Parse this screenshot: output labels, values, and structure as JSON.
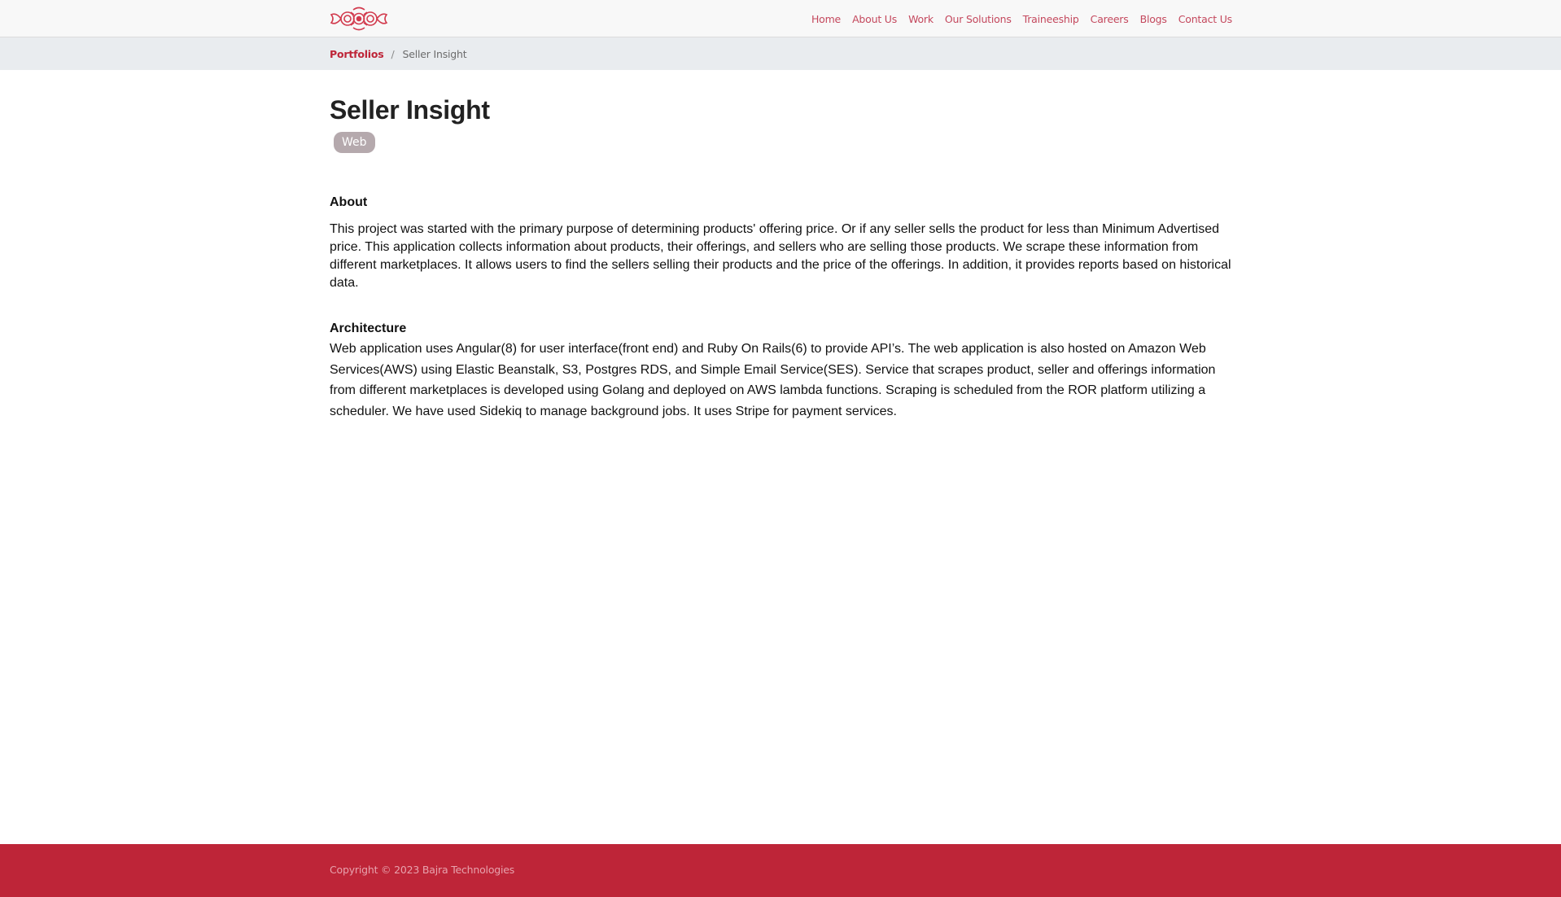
{
  "brand": {
    "logo_icon": "bajra-logo-icon",
    "accent": "#be2538"
  },
  "nav": {
    "items": [
      {
        "label": "Home"
      },
      {
        "label": "About Us"
      },
      {
        "label": "Work"
      },
      {
        "label": "Our Solutions"
      },
      {
        "label": "Traineeship"
      },
      {
        "label": "Careers"
      },
      {
        "label": "Blogs"
      },
      {
        "label": "Contact Us"
      }
    ]
  },
  "breadcrumb": {
    "parent": "Portfolios",
    "separator": "/",
    "current": "Seller Insight"
  },
  "project": {
    "title": "Seller Insight",
    "tag": "Web",
    "about_heading": "About",
    "about_text": "This project was started with the primary purpose of determining products' offering price. Or if any seller sells the product for less than Minimum Advertised price. This application collects information about products, their offerings, and sellers who are selling those products. We scrape these information from different marketplaces. It allows users to find the sellers selling their products and the price of the offerings. In addition, it provides reports based on historical data.",
    "architecture_heading": "Architecture",
    "architecture_text": "Web application uses Angular(8) for user interface(front end) and Ruby On Rails(6) to provide API’s. The web application is also hosted on  Amazon Web Services(AWS) using Elastic Beanstalk, S3, Postgres RDS, and Simple Email Service(SES). Service that scrapes product, seller and offerings information from different marketplaces is developed using Golang and deployed on AWS lambda functions. Scraping is scheduled from the ROR platform utilizing a scheduler. We have used Sidekiq to manage background jobs. It uses Stripe for payment services."
  },
  "footer": {
    "copyright": "Copyright © 2023 Bajra Technologies"
  }
}
